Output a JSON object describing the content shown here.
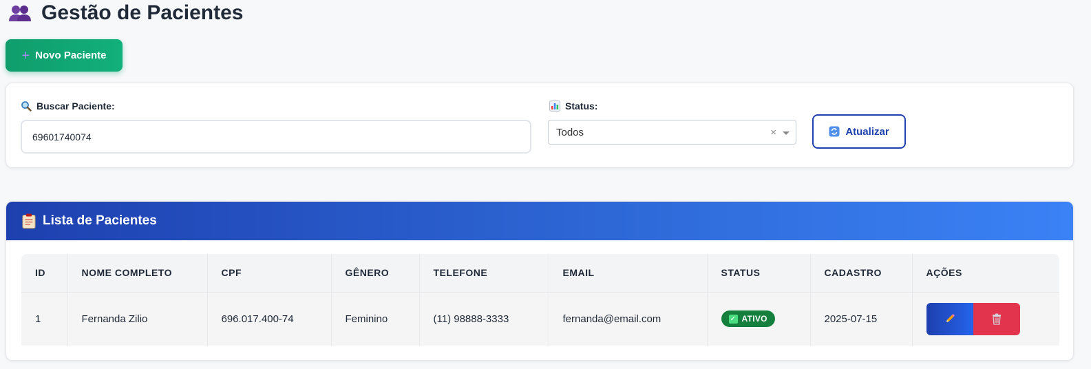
{
  "header": {
    "title": "Gestão de Pacientes",
    "icon": "people-icon"
  },
  "new_button": {
    "label": "Novo Paciente",
    "icon": "plus-icon"
  },
  "filters": {
    "search_label": "Buscar Paciente:",
    "search_value": "69601740074",
    "status_label": "Status:",
    "status_selected": "Todos",
    "refresh_label": "Atualizar"
  },
  "list": {
    "title": "Lista de Pacientes",
    "columns": [
      "ID",
      "NOME COMPLETO",
      "CPF",
      "GÊNERO",
      "TELEFONE",
      "EMAIL",
      "STATUS",
      "CADASTRO",
      "AÇÕES"
    ],
    "rows": [
      {
        "id": "1",
        "name": "Fernanda Zilio",
        "cpf": "696.017.400-74",
        "gender": "Feminino",
        "phone": "(11) 98888-3333",
        "email": "fernanda@email.com",
        "status": "ATIVO",
        "created": "2025-07-15"
      }
    ]
  },
  "colors": {
    "accent_green": "#10a070",
    "header_blue": "#1e40af",
    "status_green": "#15803d",
    "delete_red": "#e3344e"
  }
}
